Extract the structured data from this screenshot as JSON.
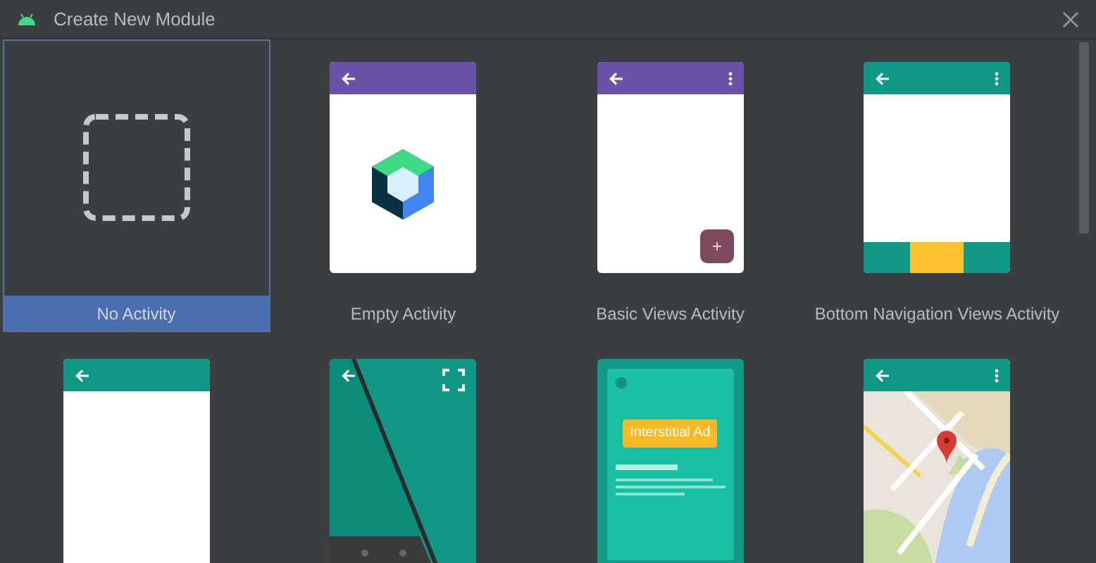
{
  "window": {
    "title": "Create New Module"
  },
  "templates": [
    {
      "kind": "none",
      "label": "No Activity",
      "selected": true
    },
    {
      "kind": "empty",
      "label": "Empty Activity",
      "selected": false
    },
    {
      "kind": "basic",
      "label": "Basic Views Activity",
      "selected": false
    },
    {
      "kind": "bottom_nav",
      "label": "Bottom Navigation Views Activity",
      "selected": false
    },
    {
      "kind": "empty_views",
      "selected": false
    },
    {
      "kind": "fullscreen",
      "selected": false
    },
    {
      "kind": "interstitial",
      "ad_label": "Interstitial Ad",
      "selected": false
    },
    {
      "kind": "map",
      "selected": false
    }
  ]
}
